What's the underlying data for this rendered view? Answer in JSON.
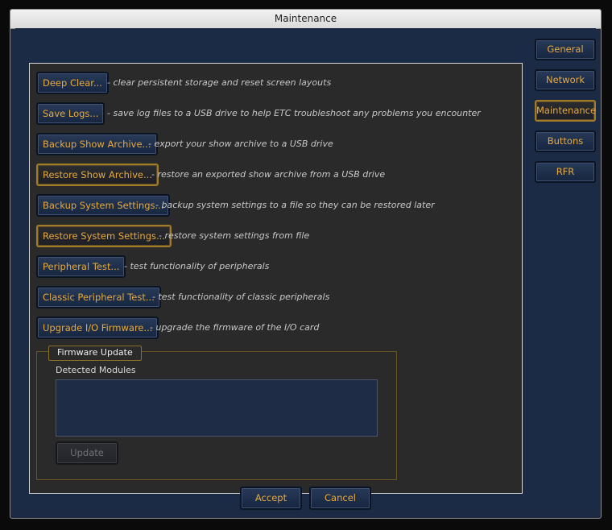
{
  "window": {
    "title": "Maintenance"
  },
  "actions": [
    {
      "label": "Deep Clear...",
      "desc": "- clear persistent storage and reset screen layouts"
    },
    {
      "label": "Save Logs...",
      "desc": "- save log files to a USB drive to help ETC troubleshoot any problems you encounter"
    },
    {
      "label": "Backup Show Archive...",
      "desc": "- export your show archive to a USB drive"
    },
    {
      "label": "Restore Show Archive...",
      "desc": "- restore an exported show archive from a USB drive"
    },
    {
      "label": "Backup System Settings...",
      "desc": "- backup system settings to a file so they can be restored later"
    },
    {
      "label": "Restore System Settings...",
      "desc": "- restore system settings from file"
    },
    {
      "label": "Peripheral Test...",
      "desc": "- test functionality of peripherals"
    },
    {
      "label": "Classic Peripheral Test...",
      "desc": "- test functionality of classic peripherals"
    },
    {
      "label": "Upgrade I/O Firmware...",
      "desc": "- upgrade the firmware of the I/O card"
    }
  ],
  "firmware": {
    "group_label": "Firmware Update",
    "detected_label": "Detected Modules",
    "update_label": "Update"
  },
  "tabs": [
    "General",
    "Network",
    "Maintenance",
    "Buttons",
    "RFR"
  ],
  "active_tab": "Maintenance",
  "footer": {
    "accept_label": "Accept",
    "cancel_label": "Cancel"
  },
  "colors": {
    "accent": "#e6a93e",
    "background": "#1c2b45",
    "panel": "#2a2a2a"
  }
}
